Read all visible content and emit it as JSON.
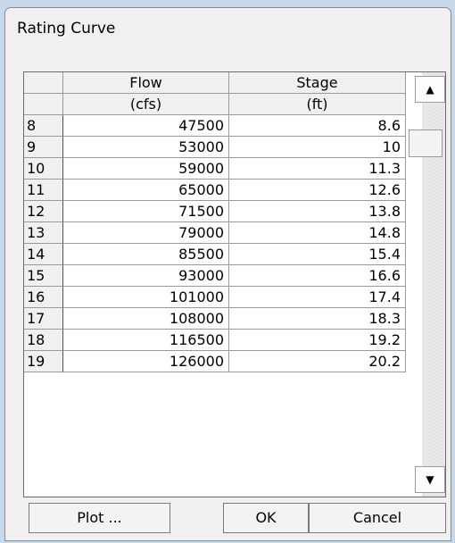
{
  "dialog": {
    "title": "Rating Curve"
  },
  "table": {
    "columns": [
      {
        "name": "Flow",
        "unit": "(cfs)"
      },
      {
        "name": "Stage",
        "unit": "(ft)"
      }
    ],
    "rows": [
      {
        "num": "8",
        "flow": "47500",
        "stage": "8.6"
      },
      {
        "num": "9",
        "flow": "53000",
        "stage": "10"
      },
      {
        "num": "10",
        "flow": "59000",
        "stage": "11.3"
      },
      {
        "num": "11",
        "flow": "65000",
        "stage": "12.6"
      },
      {
        "num": "12",
        "flow": "71500",
        "stage": "13.8"
      },
      {
        "num": "13",
        "flow": "79000",
        "stage": "14.8"
      },
      {
        "num": "14",
        "flow": "85500",
        "stage": "15.4"
      },
      {
        "num": "15",
        "flow": "93000",
        "stage": "16.6"
      },
      {
        "num": "16",
        "flow": "101000",
        "stage": "17.4"
      },
      {
        "num": "17",
        "flow": "108000",
        "stage": "18.3"
      },
      {
        "num": "18",
        "flow": "116500",
        "stage": "19.2"
      },
      {
        "num": "19",
        "flow": "126000",
        "stage": "20.2"
      }
    ]
  },
  "scrollbar": {
    "up_icon": "▲",
    "down_icon": "▼"
  },
  "buttons": {
    "plot": "Plot ...",
    "ok": "OK",
    "cancel": "Cancel"
  }
}
